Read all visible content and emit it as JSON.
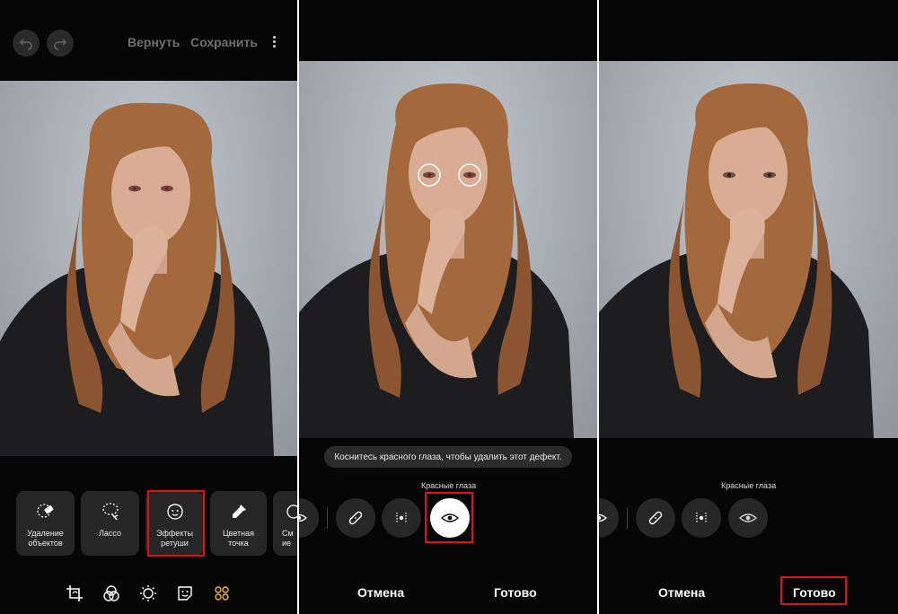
{
  "panel1": {
    "header": {
      "revert_label": "Вернуть",
      "save_label": "Сохранить"
    },
    "tools": [
      {
        "label": "Удаление\nобъектов",
        "icon": "object-eraser-icon"
      },
      {
        "label": "Лассо",
        "icon": "lasso-icon"
      },
      {
        "label": "Эффекты\nретуши",
        "icon": "face-retouch-icon",
        "highlighted": true
      },
      {
        "label": "Цветная\nточка",
        "icon": "color-picker-icon"
      },
      {
        "label": "См\nие",
        "icon": "partial-tool-icon"
      }
    ],
    "bottom_icons": [
      "crop-icon",
      "filters-icon",
      "brightness-icon",
      "sticker-icon",
      "more-tools-icon"
    ]
  },
  "panel2": {
    "tooltip": "Коснитесь красного глаза, чтобы удалить этот дефект.",
    "mode_label": "Красные глаза",
    "buttons": [
      "partial-eye-icon",
      "bandage-icon",
      "blemish-icon",
      "red-eye-icon"
    ],
    "active_button": "red-eye-icon",
    "cancel_label": "Отмена",
    "done_label": "Готово"
  },
  "panel3": {
    "mode_label": "Красные глаза",
    "cancel_label": "Отмена",
    "done_label": "Готово"
  },
  "colors": {
    "highlight": "#e0111b",
    "background": "#060606",
    "card": "#262626"
  }
}
